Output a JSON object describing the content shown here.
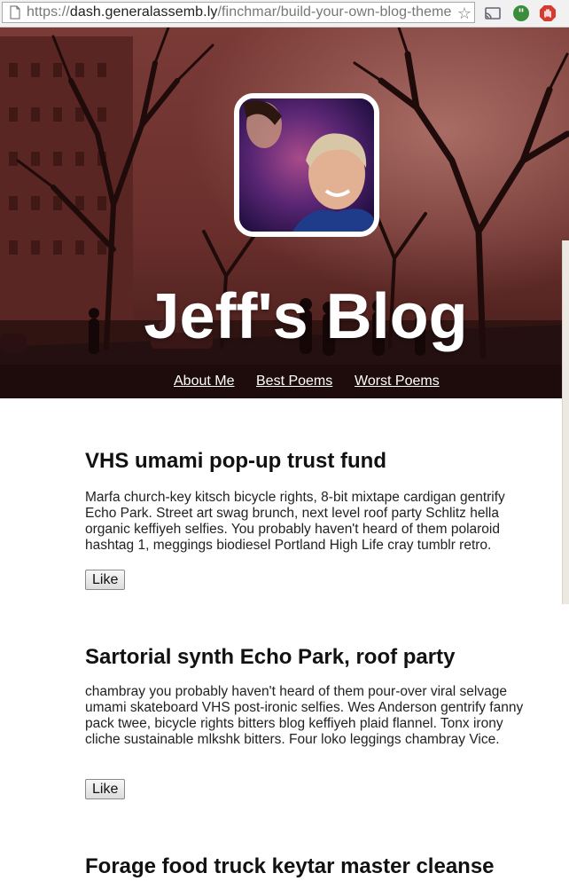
{
  "browser": {
    "url_protocol": "https://",
    "url_host": "dash.generalassemb.ly",
    "url_path": "/finchmar/build-your-own-blog-theme"
  },
  "blog": {
    "title": "Jeff's Blog",
    "nav": [
      {
        "label": "About Me"
      },
      {
        "label": "Best Poems"
      },
      {
        "label": "Worst Poems"
      }
    ]
  },
  "posts": [
    {
      "title": "VHS umami pop-up trust fund",
      "body": "Marfa church-key kitsch bicycle rights, 8-bit mixtape cardigan gentrify Echo Park. Street art swag brunch, next level roof party Schlitz hella organic keffiyeh selfies. You probably haven't heard of them polaroid hashtag 1, meggings biodiesel Portland High Life cray tumblr retro.",
      "like_label": "Like"
    },
    {
      "title": "Sartorial synth Echo Park, roof party",
      "body": "chambray you probably haven't heard of them pour-over viral selvage umami skateboard VHS post-ironic selfies. Wes Anderson gentrify fanny pack twee, bicycle rights bitters blog keffiyeh plaid flannel. Tonx irony cliche sustainable mlkshk bitters. Four loko leggings chambray Vice.",
      "like_label": "Like"
    },
    {
      "title": "Forage food truck keytar master cleanse"
    }
  ],
  "icons": {
    "page": "page-icon",
    "bookmark": "star-icon",
    "cast": "cast-icon",
    "quote": "quote-extension-icon",
    "adblock": "stop-hand-icon"
  }
}
